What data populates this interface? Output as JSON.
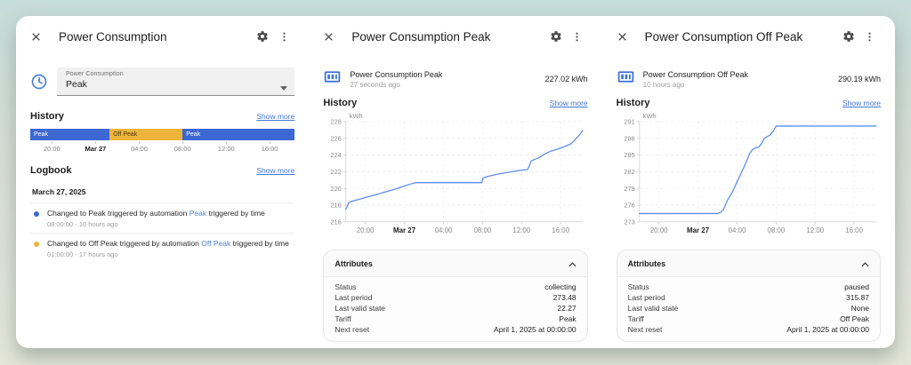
{
  "colors": {
    "accent_blue": "#3d68d2",
    "accent_orange": "#eeb43c",
    "link": "#4379d8",
    "chart_line": "#5f8df0"
  },
  "dialogs": [
    {
      "title": "Power Consumption",
      "select": {
        "label": "Power Consumption",
        "value": "Peak"
      },
      "history_label": "History",
      "logbook_label": "Logbook",
      "show_more": "Show more",
      "logbook": {
        "date": "March 27, 2025",
        "entries": [
          {
            "dot_color": "#3d68d2",
            "text": "Changed to Peak triggered by automation",
            "link": "Peak",
            "text_after": "triggered by time",
            "time": "08:00:00 - 10 hours ago"
          },
          {
            "dot_color": "#eeb43c",
            "text": "Changed to Off Peak triggered by automation",
            "link": "Off Peak",
            "text_after": "triggered by time",
            "time": "01:00:00 - 17 hours ago"
          }
        ]
      }
    },
    {
      "title": "Power Consumption Peak",
      "entity": {
        "name": "Power Consumption Peak",
        "last_changed": "27 seconds ago",
        "state": "227.02 kWh"
      },
      "history_label": "History",
      "show_more": "Show more",
      "attributes_label": "Attributes",
      "attributes": [
        {
          "key": "Status",
          "value": "collecting"
        },
        {
          "key": "Last period",
          "value": "273.48"
        },
        {
          "key": "Last valid state",
          "value": "22.27"
        },
        {
          "key": "Tariff",
          "value": "Peak"
        },
        {
          "key": "Next reset",
          "value": "April 1, 2025 at 00:00:00"
        }
      ]
    },
    {
      "title": "Power Consumption Off Peak",
      "entity": {
        "name": "Power Consumption Off Peak",
        "last_changed": "10 hours ago",
        "state": "290.19 kWh"
      },
      "history_label": "History",
      "show_more": "Show more",
      "attributes_label": "Attributes",
      "attributes": [
        {
          "key": "Status",
          "value": "paused"
        },
        {
          "key": "Last period",
          "value": "315.87"
        },
        {
          "key": "Last valid state",
          "value": "None"
        },
        {
          "key": "Tariff",
          "value": "Off Peak"
        },
        {
          "key": "Next reset",
          "value": "April 1, 2025 at 00:00:00"
        }
      ]
    }
  ],
  "chart_data": [
    {
      "type": "timeline",
      "title": "Power Consumption state timeline (Mar 26 18:00 - Mar 27 18:15)",
      "segments": [
        {
          "label": "Peak",
          "from_pct": 0,
          "to_pct": 30,
          "color": "#3d68d2",
          "text_color": "#ffffff"
        },
        {
          "label": "Off Peak",
          "from_pct": 30,
          "to_pct": 57.6,
          "color": "#eeb43c",
          "text_color": "#4a3a12"
        },
        {
          "label": "Peak",
          "from_pct": 57.6,
          "to_pct": 100,
          "color": "#3d68d2",
          "text_color": "#ffffff"
        }
      ],
      "xticks": [
        {
          "pct": 8.2,
          "label": "20:00"
        },
        {
          "pct": 24.7,
          "label": "Mar 27",
          "bold": true
        },
        {
          "pct": 41.2,
          "label": "04:00"
        },
        {
          "pct": 57.6,
          "label": "08:00"
        },
        {
          "pct": 74.1,
          "label": "12:00"
        },
        {
          "pct": 90.5,
          "label": "16:00"
        }
      ]
    },
    {
      "type": "line",
      "title": "Power Consumption Peak history",
      "ylabel": "kWh",
      "ylim": [
        216,
        228
      ],
      "yticks": [
        216,
        218,
        220,
        222,
        224,
        226,
        228
      ],
      "xlim": [
        0,
        24.3
      ],
      "xticks": [
        {
          "h": 2,
          "label": "20:00"
        },
        {
          "h": 6,
          "label": "Mar 27",
          "bold": true
        },
        {
          "h": 10,
          "label": "04:00"
        },
        {
          "h": 14,
          "label": "08:00"
        },
        {
          "h": 18,
          "label": "12:00"
        },
        {
          "h": 22,
          "label": "16:00"
        }
      ],
      "line_color": "#5f8df0",
      "grid": true,
      "points": [
        [
          0,
          217.5
        ],
        [
          0.3,
          218.3
        ],
        [
          0.6,
          218.45
        ],
        [
          2.0,
          218.9
        ],
        [
          3.5,
          219.4
        ],
        [
          5.0,
          219.9
        ],
        [
          6.0,
          220.3
        ],
        [
          7.0,
          220.65
        ],
        [
          7.2,
          220.7
        ],
        [
          13.95,
          220.7
        ],
        [
          14.05,
          221.25
        ],
        [
          14.6,
          221.45
        ],
        [
          15.5,
          221.7
        ],
        [
          16.5,
          221.9
        ],
        [
          17.5,
          222.1
        ],
        [
          18.0,
          222.2
        ],
        [
          18.6,
          222.25
        ],
        [
          18.75,
          222.6
        ],
        [
          19.0,
          223.3
        ],
        [
          19.3,
          223.45
        ],
        [
          19.8,
          223.7
        ],
        [
          20.5,
          224.2
        ],
        [
          21.0,
          224.45
        ],
        [
          21.8,
          224.75
        ],
        [
          22.5,
          225.05
        ],
        [
          23.0,
          225.3
        ],
        [
          23.3,
          225.6
        ],
        [
          23.7,
          226.1
        ],
        [
          24.0,
          226.5
        ],
        [
          24.25,
          226.95
        ]
      ]
    },
    {
      "type": "line",
      "title": "Power Consumption Off Peak history",
      "ylabel": "kWh",
      "ylim": [
        273,
        291
      ],
      "yticks": [
        273,
        276,
        279,
        282,
        285,
        288,
        291
      ],
      "xlim": [
        0,
        24.3
      ],
      "xticks": [
        {
          "h": 2,
          "label": "20:00"
        },
        {
          "h": 6,
          "label": "Mar 27",
          "bold": true
        },
        {
          "h": 10,
          "label": "04:00"
        },
        {
          "h": 14,
          "label": "08:00"
        },
        {
          "h": 18,
          "label": "12:00"
        },
        {
          "h": 22,
          "label": "16:00"
        }
      ],
      "line_color": "#5f8df0",
      "grid": true,
      "points": [
        [
          0,
          274.5
        ],
        [
          8.0,
          274.5
        ],
        [
          8.3,
          274.7
        ],
        [
          8.6,
          275.2
        ],
        [
          9.0,
          276.8
        ],
        [
          9.5,
          278.3
        ],
        [
          10.0,
          280.2
        ],
        [
          10.5,
          282.0
        ],
        [
          11.0,
          284.0
        ],
        [
          11.3,
          285.3
        ],
        [
          11.6,
          286.0
        ],
        [
          11.9,
          286.3
        ],
        [
          12.2,
          286.4
        ],
        [
          12.5,
          287.0
        ],
        [
          12.8,
          288.0
        ],
        [
          13.1,
          288.3
        ],
        [
          13.4,
          288.6
        ],
        [
          13.7,
          289.3
        ],
        [
          14.0,
          290.19
        ],
        [
          24.25,
          290.19
        ]
      ]
    }
  ]
}
